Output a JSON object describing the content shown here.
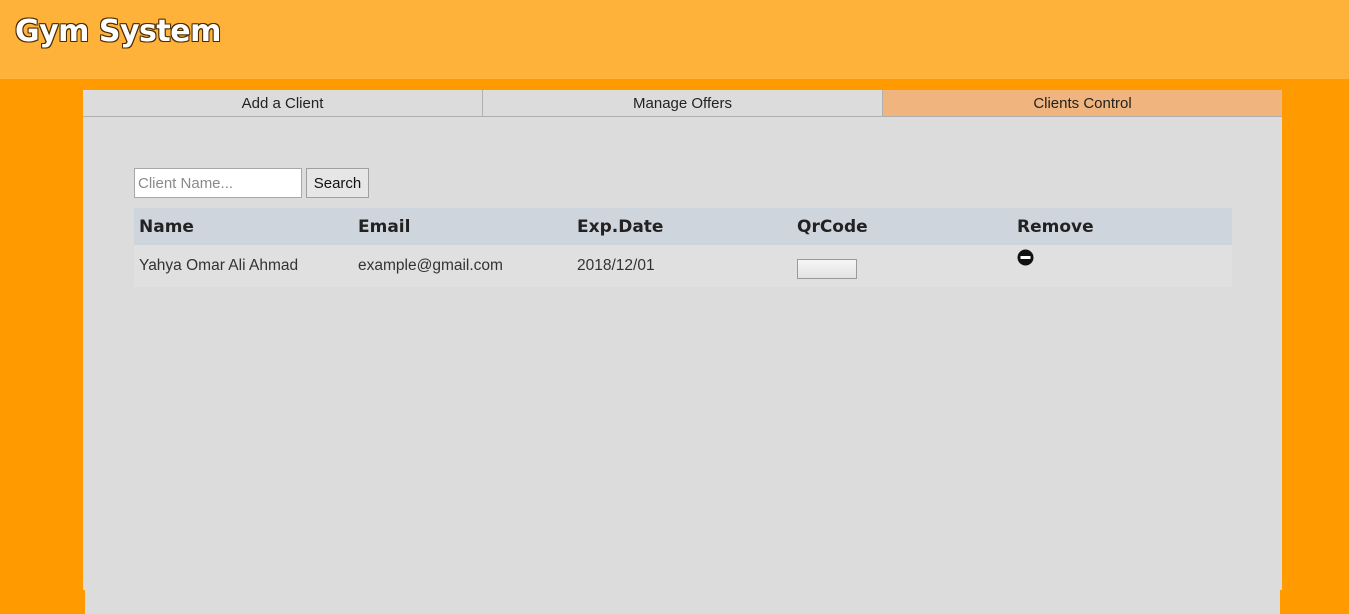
{
  "app": {
    "title": "Gym System"
  },
  "tabs": [
    {
      "label": "Add a Client",
      "active": false
    },
    {
      "label": "Manage Offers",
      "active": false
    },
    {
      "label": "Clients Control",
      "active": true
    }
  ],
  "search": {
    "placeholder": "Client Name...",
    "value": "",
    "button_label": "Search"
  },
  "table": {
    "columns": [
      "Name",
      "Email",
      "Exp.Date",
      "QrCode",
      "Remove"
    ],
    "rows": [
      {
        "name": "Yahya Omar Ali Ahmad",
        "email": "example@gmail.com",
        "exp_date": "2018/12/01",
        "qrcode_label": "",
        "remove_icon": "minus-circle-icon"
      }
    ]
  },
  "colors": {
    "background": "#ff9b00",
    "header": "#ffb23a",
    "panel": "#dcdcdc",
    "active_tab": "#f0b47e",
    "table_header": "#cfd5dd"
  }
}
